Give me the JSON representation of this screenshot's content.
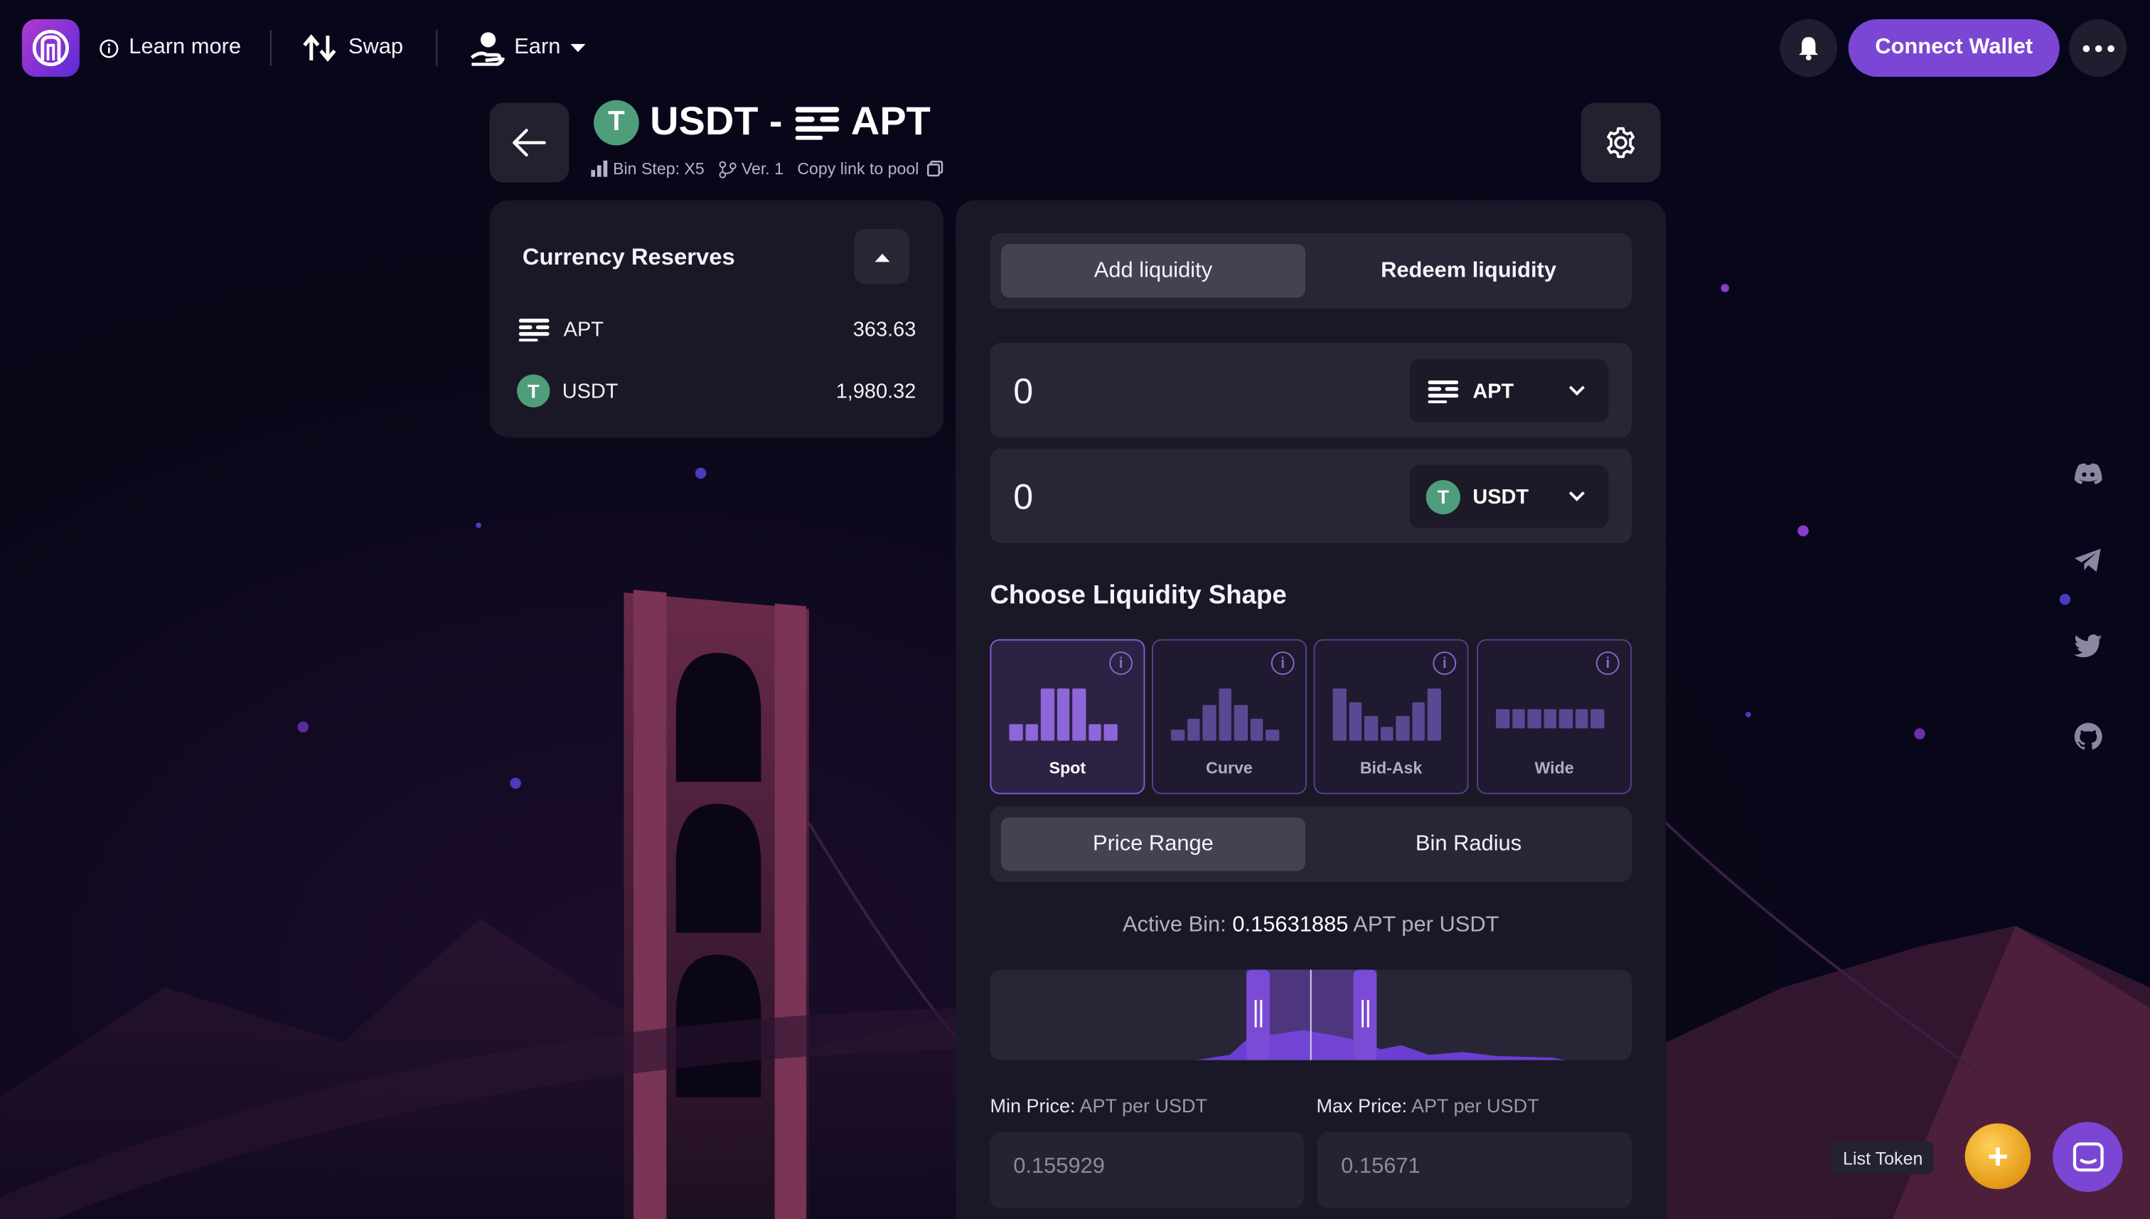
{
  "nav": {
    "learn_more": "Learn more",
    "swap": "Swap",
    "earn": "Earn",
    "connect_wallet": "Connect Wallet"
  },
  "pool": {
    "token_a": "USDT",
    "separator": "-",
    "token_b": "APT",
    "bin_step": "Bin Step: X5",
    "version": "Ver. 1",
    "copy_link": "Copy link to pool"
  },
  "reserves": {
    "title": "Currency Reserves",
    "items": [
      {
        "symbol": "APT",
        "amount": "363.63"
      },
      {
        "symbol": "USDT",
        "amount": "1,980.32"
      }
    ]
  },
  "liquidity": {
    "tabs": [
      "Add liquidity",
      "Redeem liquidity"
    ],
    "active_tab": "Add liquidity",
    "inputs": [
      {
        "value": "0",
        "token": "APT"
      },
      {
        "value": "0",
        "token": "USDT"
      }
    ],
    "shape_title": "Choose Liquidity Shape",
    "shapes": [
      "Spot",
      "Curve",
      "Bid-Ask",
      "Wide"
    ],
    "active_shape": "Spot",
    "range_tabs": [
      "Price Range",
      "Bin Radius"
    ],
    "active_range_tab": "Price Range",
    "active_bin_label": "Active Bin:",
    "active_bin_value": "0.15631885",
    "active_bin_unit": "APT per USDT",
    "min_price_label": "Min Price:",
    "max_price_label": "Max Price:",
    "price_unit": "APT per USDT",
    "min_price": "0.155929",
    "max_price": "0.15671"
  },
  "footer": {
    "list_token": "List Token"
  },
  "colors": {
    "accent": "#7b46d4",
    "usdt": "#4e9e7b",
    "panel": "#1a1826"
  },
  "icons": [
    "info-icon",
    "swap-arrows-icon",
    "user-hand-icon",
    "bell-icon",
    "more-icon",
    "back-arrow-icon",
    "gear-icon",
    "discord-icon",
    "telegram-icon",
    "twitter-icon",
    "github-icon",
    "chat-icon"
  ]
}
